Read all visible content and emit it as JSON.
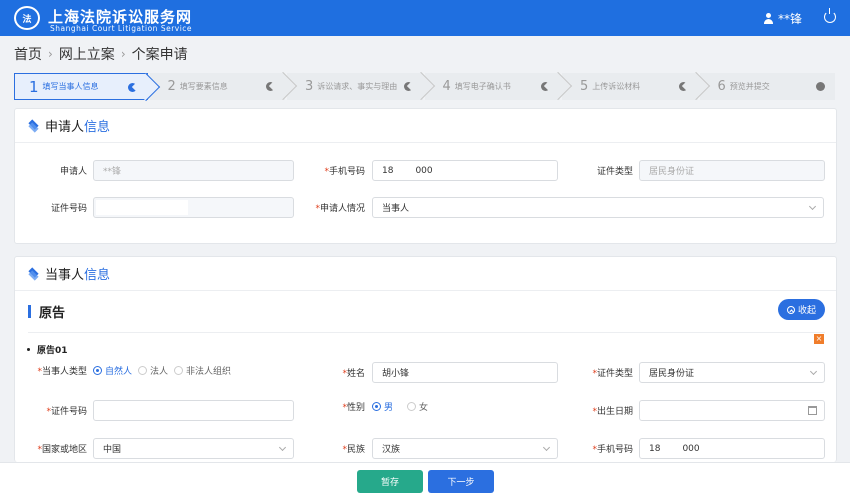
{
  "header": {
    "seal_text": "法",
    "title_cn": "上海法院诉讼服务网",
    "title_en": "Shanghai Court Litigation Service",
    "username": "**锋"
  },
  "breadcrumb": [
    "首页",
    "网上立案",
    "个案申请"
  ],
  "steps": [
    {
      "num": "1",
      "label": "填写当事人信息"
    },
    {
      "num": "2",
      "label": "填写要素信息"
    },
    {
      "num": "3",
      "label": "诉讼请求、事实与理由"
    },
    {
      "num": "4",
      "label": "填写电子确认书"
    },
    {
      "num": "5",
      "label": "上传诉讼材料"
    },
    {
      "num": "6",
      "label": "预览并提交"
    }
  ],
  "applicant": {
    "title_a": "申请人",
    "title_b": "信息",
    "name_label": "申请人",
    "name_value": "**锋",
    "phone_label": "手机号码",
    "phone_prefix": "18",
    "phone_suffix": "000",
    "idtype_label": "证件类型",
    "idtype_value": "居民身份证",
    "idno_label": "证件号码",
    "situation_label": "申请人情况",
    "situation_value": "当事人"
  },
  "party": {
    "title_a": "当事人",
    "title_b": "信息",
    "section": "原告",
    "collapse_label": "收起",
    "sub": "原告01",
    "type_label": "当事人类型",
    "type_options": [
      "自然人",
      "法人",
      "非法人组织"
    ],
    "name_label": "姓名",
    "name_value": "胡小锋",
    "idtype_label": "证件类型",
    "idtype_value": "居民身份证",
    "idno_label": "证件号码",
    "gender_label": "性别",
    "gender_options": [
      "男",
      "女"
    ],
    "birth_label": "出生日期",
    "country_label": "国家或地区",
    "country_value": "中国",
    "ethnic_label": "民族",
    "ethnic_value": "汉族",
    "phone_label": "手机号码",
    "phone_prefix": "18",
    "phone_suffix": "000"
  },
  "footer": {
    "save_label": "暂存",
    "next_label": "下一步"
  },
  "colors": {
    "header": "#1f6fe0",
    "primary": "#2b6fe0",
    "save": "#26a98b",
    "required": "#e0401e"
  }
}
